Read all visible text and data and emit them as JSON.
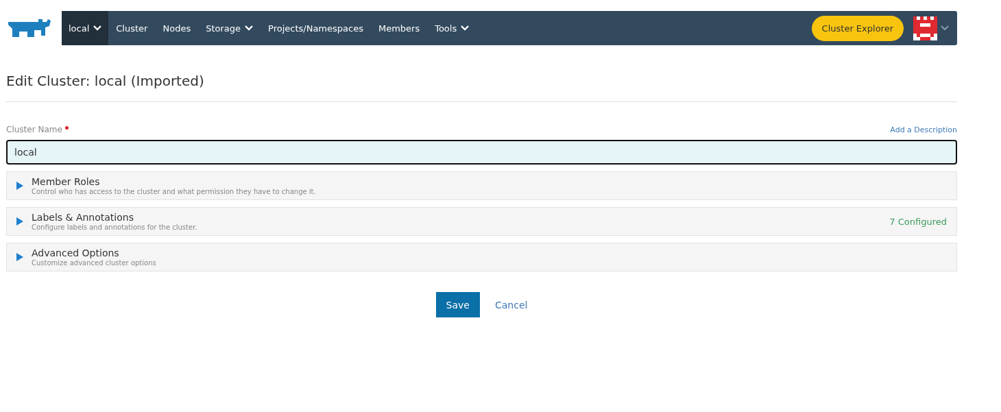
{
  "nav": {
    "items": [
      {
        "label": "local",
        "selected": true,
        "dropdown": true
      },
      {
        "label": "Cluster",
        "selected": false,
        "dropdown": false
      },
      {
        "label": "Nodes",
        "selected": false,
        "dropdown": false
      },
      {
        "label": "Storage",
        "selected": false,
        "dropdown": true
      },
      {
        "label": "Projects/Namespaces",
        "selected": false,
        "dropdown": false
      },
      {
        "label": "Members",
        "selected": false,
        "dropdown": false
      },
      {
        "label": "Tools",
        "selected": false,
        "dropdown": true
      }
    ],
    "explorer_button": "Cluster Explorer"
  },
  "page_title": "Edit Cluster: local (Imported)",
  "cluster_name": {
    "label": "Cluster Name",
    "required": true,
    "value": "local",
    "add_description": "Add a Description"
  },
  "sections": [
    {
      "title": "Member Roles",
      "description": "Control who has access to the cluster and what permission they have to change it.",
      "expanded": false
    },
    {
      "title": "Labels & Annotations",
      "description": "Configure labels and annotations for the cluster.",
      "expanded": false,
      "status": "7 Configured"
    },
    {
      "title": "Advanced Options",
      "description": "Customize advanced cluster options",
      "expanded": false
    }
  ],
  "buttons": {
    "save": "Save",
    "cancel": "Cancel"
  }
}
